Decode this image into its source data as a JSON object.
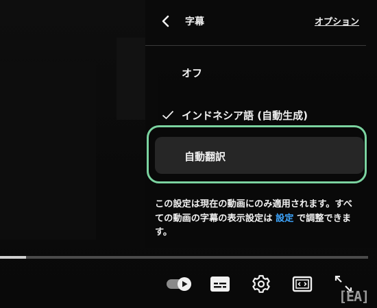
{
  "panel": {
    "title": "字幕",
    "options_label": "オプション",
    "items": [
      {
        "label": "オフ",
        "checked": false
      },
      {
        "label": "インドネシア語 (自動生成)",
        "checked": true
      },
      {
        "label": "自動翻訳",
        "checked": false,
        "highlighted": true
      }
    ],
    "note": {
      "text": "この設定は現在の動画にのみ適用されます。すべての動画の字幕の表示設定は",
      "link": "設定",
      "suffix": "で調整できます。"
    }
  },
  "player": {
    "progress": 0.07,
    "controls": [
      "autoplay-toggle",
      "subtitles-icon",
      "gear-icon",
      "theater-mode-icon",
      "fullscreen-icon"
    ]
  },
  "watermark": "[EA]",
  "colors": {
    "highlight_border": "#7bd3a0",
    "link": "#3ea6ff"
  }
}
